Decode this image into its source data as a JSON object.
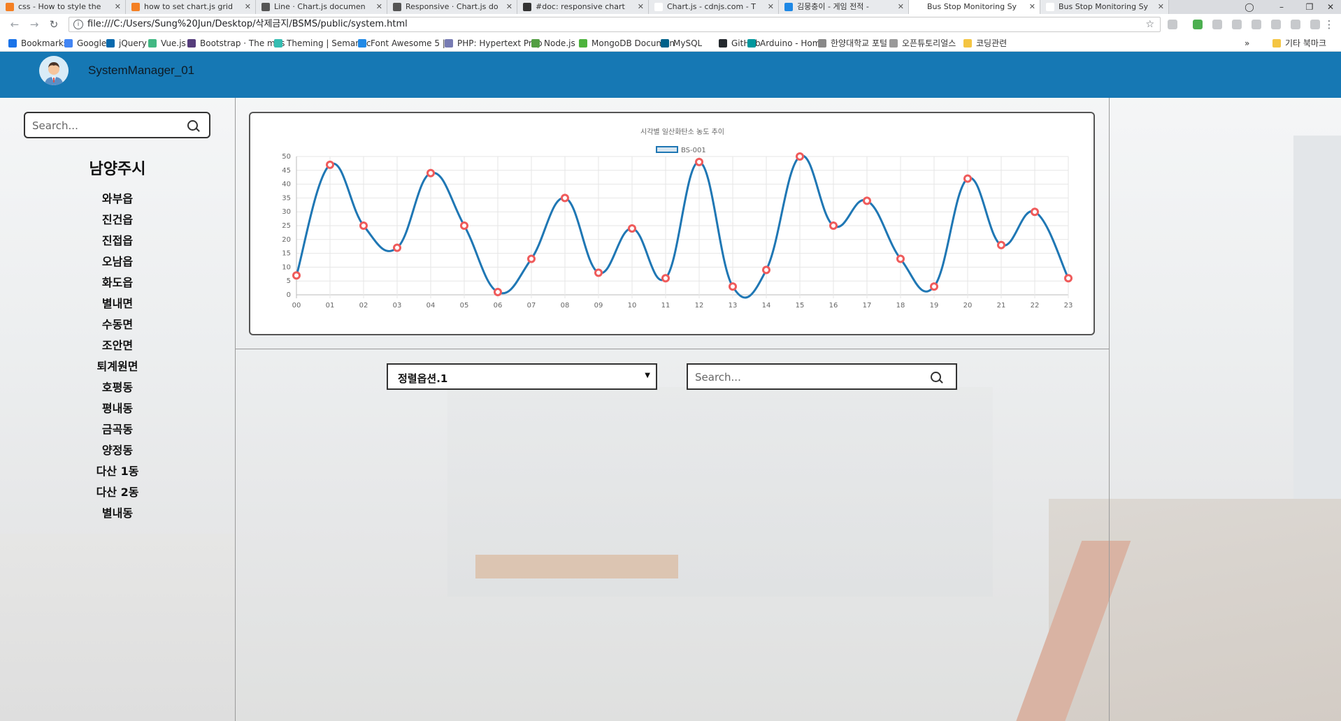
{
  "browser": {
    "tabs": [
      {
        "title": "css - How to style the",
        "favicon_color": "#f48024"
      },
      {
        "title": "how to set chart.js grid",
        "favicon_color": "#f48024"
      },
      {
        "title": "Line · Chart.js documen",
        "favicon_color": "#555555"
      },
      {
        "title": "Responsive · Chart.js do",
        "favicon_color": "#555555"
      },
      {
        "title": "#doc: responsive chart",
        "favicon_color": "#333333"
      },
      {
        "title": "Chart.js - cdnjs.com - T",
        "favicon_color": "#ffffff"
      },
      {
        "title": "김뭉충이 - 게임 전적 -",
        "favicon_color": "#1e88e5"
      },
      {
        "title": "Bus Stop Monitoring Sy",
        "favicon_color": "#ffffff"
      },
      {
        "title": "Bus Stop Monitoring Sy",
        "favicon_color": "#ffffff"
      }
    ],
    "active_tab": 7,
    "url": "file:///C:/Users/Sung%20Jun/Desktop/삭제금지/BSMS/public/system.html",
    "bookmarks": [
      {
        "label": "Bookmarks",
        "color": "#1a73e8"
      },
      {
        "label": "Google",
        "color": "#4285f4"
      },
      {
        "label": "jQuery",
        "color": "#0769ad"
      },
      {
        "label": "Vue.js",
        "color": "#41b883"
      },
      {
        "label": "Bootstrap · The mos",
        "color": "#563d7c"
      },
      {
        "label": "Theming | Semantic",
        "color": "#35bdb2"
      },
      {
        "label": "Font Awesome 5 | F",
        "color": "#228ae6"
      },
      {
        "label": "PHP: Hypertext Prep",
        "color": "#777bb3"
      },
      {
        "label": "Node.js",
        "color": "#539e43"
      },
      {
        "label": "MongoDB Documen",
        "color": "#4db33d"
      },
      {
        "label": "MySQL",
        "color": "#00618a"
      },
      {
        "label": "GitHub",
        "color": "#24292e"
      },
      {
        "label": "Arduino - Home",
        "color": "#00979d"
      },
      {
        "label": "한양대학교 포털",
        "color": "#888888"
      },
      {
        "label": "오픈튜토리얼스",
        "color": "#999999"
      },
      {
        "label": "코딩관련",
        "color": "#f4c542"
      }
    ],
    "bookmarks_overflow": "»",
    "other_bookmarks": "기타 북마크"
  },
  "app": {
    "header_color": "#1678b4",
    "user_name": "SystemManager_01",
    "sidebar": {
      "search_placeholder": "Search...",
      "city": "남양주시",
      "districts": [
        "와부읍",
        "진건읍",
        "진접읍",
        "오남읍",
        "화도읍",
        "별내면",
        "수동면",
        "조안면",
        "퇴계원면",
        "호평동",
        "평내동",
        "금곡동",
        "양정동",
        "다산 1동",
        "다산 2동",
        "별내동"
      ]
    },
    "sort_select": "정렬옵션.1",
    "main_search_placeholder": "Search..."
  },
  "chart_data": {
    "type": "line",
    "title": "시각별 일산화탄소 농도 추이",
    "x": [
      "00",
      "01",
      "02",
      "03",
      "04",
      "05",
      "06",
      "07",
      "08",
      "09",
      "10",
      "11",
      "12",
      "13",
      "14",
      "15",
      "16",
      "17",
      "18",
      "19",
      "20",
      "21",
      "22",
      "23"
    ],
    "series": [
      {
        "name": "BS-001",
        "values": [
          7,
          47,
          25,
          17,
          44,
          25,
          1,
          13,
          35,
          8,
          24,
          6,
          48,
          3,
          9,
          50,
          25,
          34,
          13,
          3,
          42,
          18,
          30,
          6
        ],
        "color": "#1f77b4",
        "point_color": "#ef5b5b"
      }
    ],
    "ylim": [
      0,
      50
    ],
    "yticks": [
      0,
      5,
      10,
      15,
      20,
      25,
      30,
      35,
      40,
      45,
      50
    ],
    "grid": true,
    "legend": "top",
    "smooth": true
  }
}
